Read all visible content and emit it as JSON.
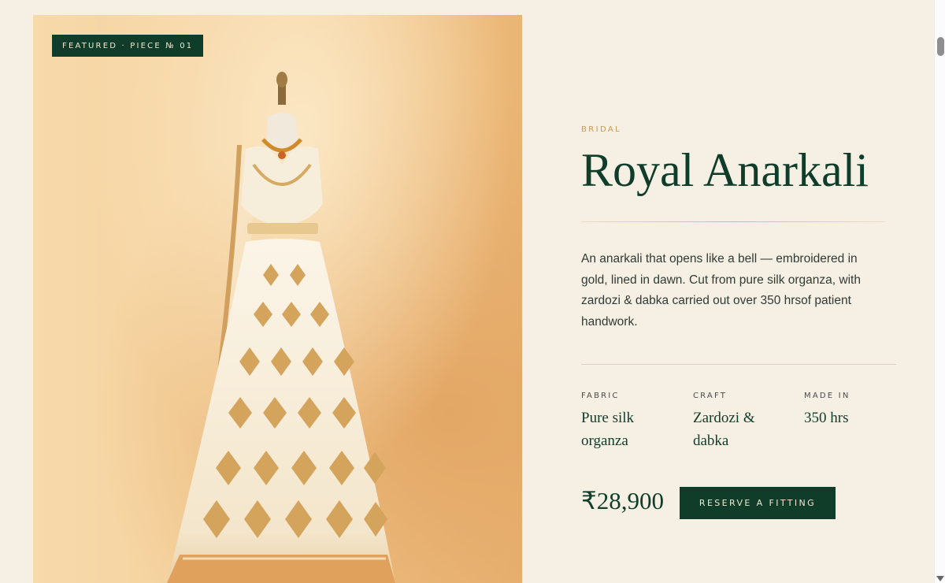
{
  "badge": "FEATURED · PIECE № 01",
  "product": {
    "category": "BRIDAL",
    "name": "Royal Anarkali",
    "description": "An anarkali that opens like a bell — embroidered in gold, lined in dawn. Cut from pure silk organza, with zardozi & dabka carried out over 350 hrsof patient handwork.",
    "specs": [
      {
        "label": "FABRIC",
        "value": "Pure silk organza"
      },
      {
        "label": "CRAFT",
        "value": "Zardozi & dabka"
      },
      {
        "label": "MADE IN",
        "value": "350 hrs"
      }
    ],
    "price": "₹28,900",
    "cta": "RESERVE A FITTING"
  },
  "colors": {
    "accent": "#0f3d2a",
    "gold": "#c49b52",
    "background": "#f6efe4"
  }
}
